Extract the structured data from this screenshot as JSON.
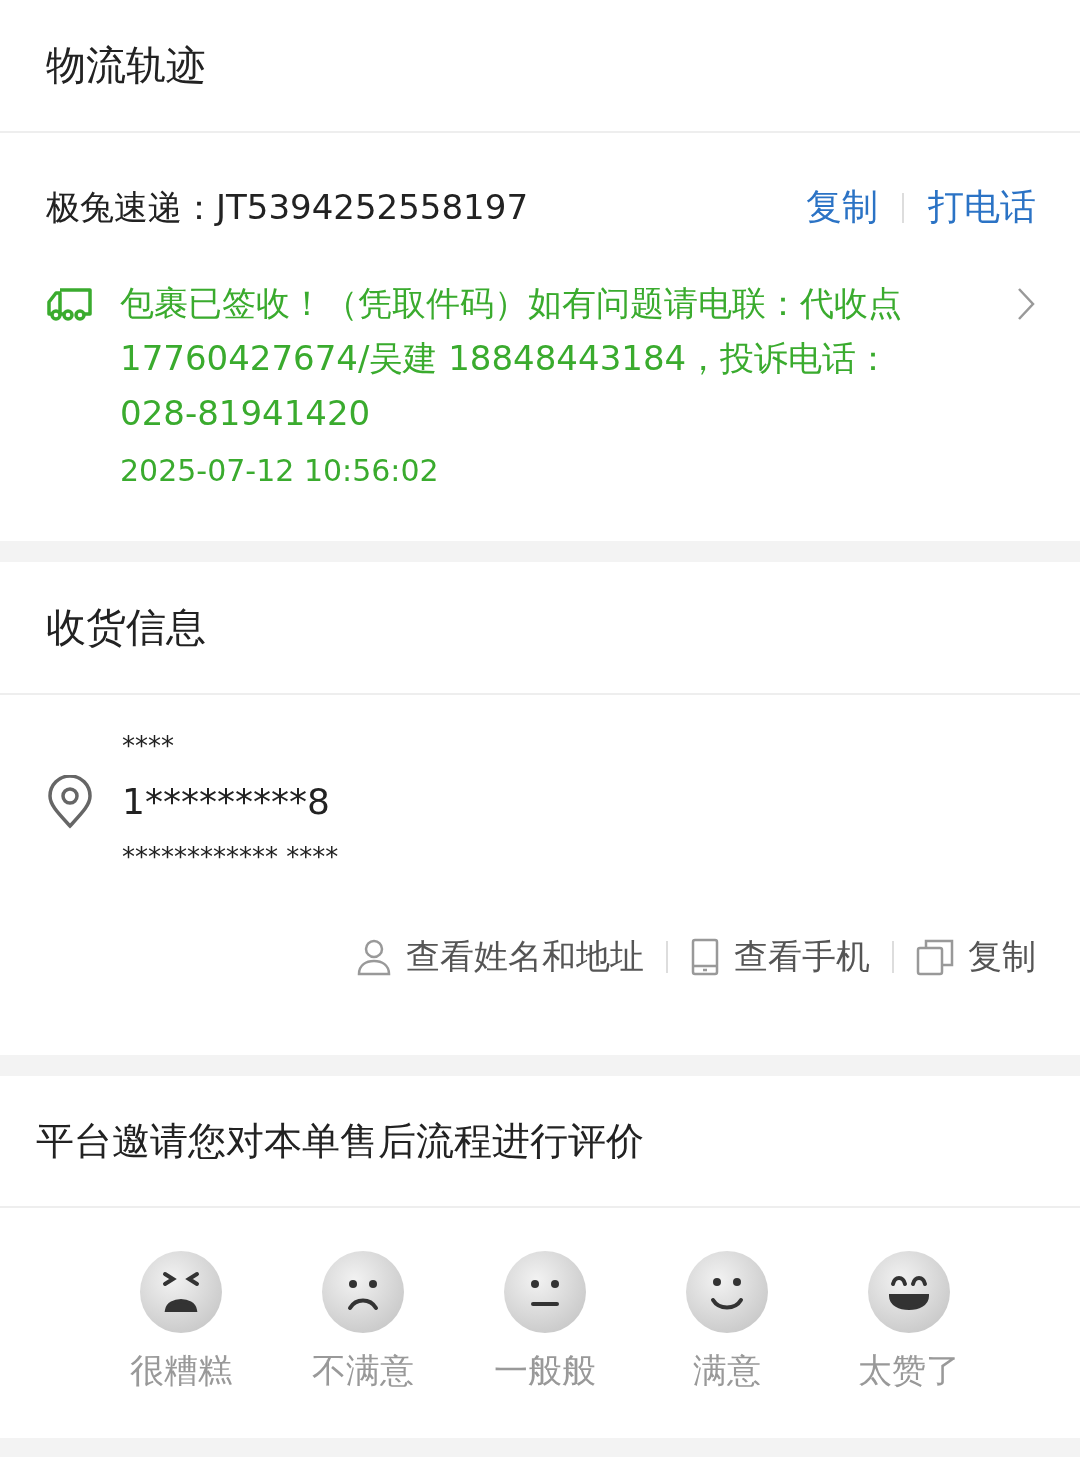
{
  "logistics_header": {
    "title": "物流轨迹"
  },
  "logistics": {
    "courier": "极兔速递：",
    "tracking_number": "JT5394252558197",
    "actions": [
      "复制",
      "打电话"
    ],
    "status": "包裹已签收！（凭取件码）如有问题请电联：代收点 17760427674/吴建 18848443184，投诉电话：028-81941420",
    "time": "2025-07-12 10:56:02"
  },
  "receiver_header": {
    "title": "收货信息"
  },
  "receiver": {
    "name": "****",
    "phone": "1*********8",
    "address": "************ ****",
    "actions": [
      {
        "kind": "person",
        "label": "查看姓名和地址"
      },
      {
        "kind": "phone",
        "label": "查看手机"
      },
      {
        "kind": "copy",
        "label": "复制"
      }
    ]
  },
  "rating": {
    "title": "平台邀请您对本单售后流程进行评价",
    "options": [
      {
        "kind": "awful",
        "label": "很糟糕"
      },
      {
        "kind": "unhappy",
        "label": "不满意"
      },
      {
        "kind": "neutral",
        "label": "一般般"
      },
      {
        "kind": "satisfied",
        "label": "满意"
      },
      {
        "kind": "great",
        "label": "太赞了"
      }
    ]
  }
}
